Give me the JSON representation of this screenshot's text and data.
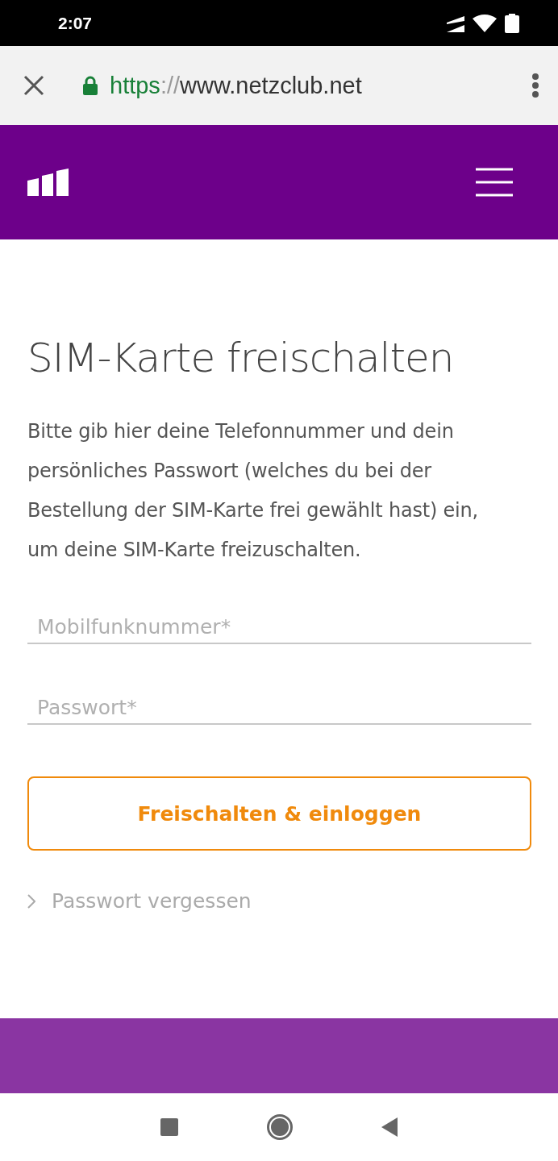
{
  "status_bar": {
    "time": "2:07"
  },
  "browser": {
    "url": {
      "scheme": "https",
      "separator": "://",
      "host": "www.netzclub.net"
    }
  },
  "page": {
    "title": "SIM-Karte freischalten",
    "intro": "Bitte gib hier deine Telefonnummer und dein persönliches Passwort (welches du bei der Bestellung der SIM-Karte frei gewählt hast) ein, um deine SIM-Karte freizuschalten.",
    "fields": [
      {
        "placeholder": "Mobilfunknummer*"
      },
      {
        "placeholder": "Passwort*"
      }
    ],
    "submit": "Freischalten & einloggen",
    "forgot_link": "Passwort vergessen"
  }
}
